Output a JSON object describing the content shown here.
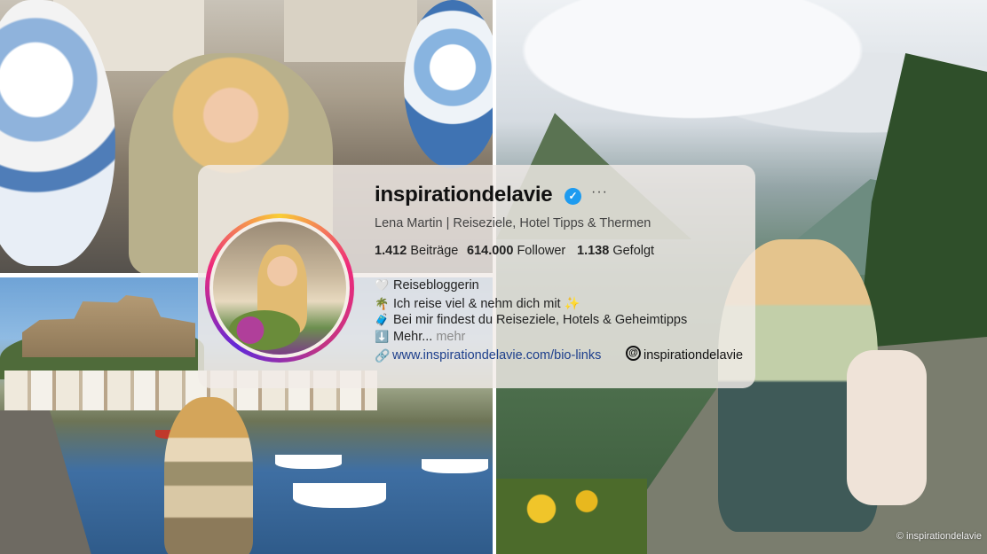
{
  "profile": {
    "username": "inspirationdelavie",
    "verified_icon": "verified-badge-icon",
    "more_icon": "···",
    "full_name": "Lena Martin | Reiseziele, Hotel Tipps & Thermen",
    "stats": {
      "posts_count": "1.412",
      "posts_label": "Beiträge",
      "followers_count": "614.000",
      "followers_label": "Follower",
      "following_count": "1.138",
      "following_label": "Gefolgt"
    },
    "bio": [
      {
        "emoji": "🤍",
        "text": "Reisebloggerin"
      },
      {
        "emoji": "🌴",
        "text": "Ich reise viel & nehm dich mit ✨"
      },
      {
        "emoji": "🧳",
        "text": "Bei mir findest du Reiseziele, Hotels & Geheimtipps"
      },
      {
        "emoji": "⬇️",
        "text": "Mehr...",
        "more": "mehr"
      }
    ],
    "link_icon": "link-icon",
    "link": "www.inspirationdelavie.com/bio-links",
    "threads_icon": "threads-icon",
    "threads_handle": "inspirationdelavie"
  },
  "photos": {
    "top_left": "street-photo",
    "bottom_left": "harbour-photo",
    "right": "mountain-photo"
  },
  "watermark": "© inspirationdelavie",
  "colors": {
    "verified_blue": "#1d9bf0",
    "link_blue": "#1d3f8c",
    "ring_gradient": [
      "#f9ce34",
      "#ee2a7b",
      "#6228d7"
    ]
  }
}
